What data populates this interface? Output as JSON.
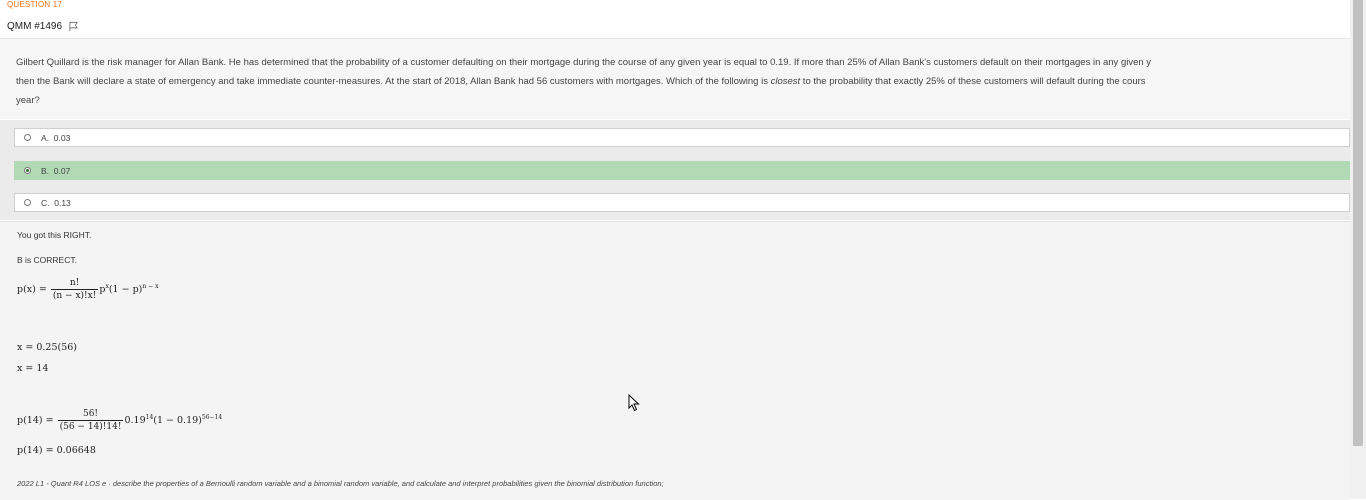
{
  "header": {
    "section_label": "QUESTION 17",
    "question_id": "QMM #1496"
  },
  "question": {
    "line1": "Gilbert Quillard is the risk manager for Allan Bank.  He has determined that the probability of a customer defaulting on their mortgage during the course of any given year is equal to 0.19.  If more than 25% of Allan Bank's customers default on their mortgages in any given y",
    "line2_pre": "then the Bank will declare a state of emergency and take immediate counter-measures.  At the start of 2018, Allan Bank had 56 customers with mortgages.  Which of the following is ",
    "line2_em": "closest",
    "line2_post": " to the probability that exactly 25% of these customers will default during the cours",
    "line3": "year?"
  },
  "options": [
    {
      "letter": "A.",
      "value": "0.03",
      "selected": false
    },
    {
      "letter": "B.",
      "value": "0.07",
      "selected": true
    },
    {
      "letter": "C.",
      "value": "0.13",
      "selected": false
    }
  ],
  "explanation": {
    "result": "You got this RIGHT.",
    "correct": "B is CORRECT.",
    "formula_lhs": "p(x) =",
    "formula_num": "n!",
    "formula_den": "(n − x)!x!",
    "x_line1": "x = 0.25(56)",
    "x_line2": "x = 14",
    "calc_lhs": "p(14) =",
    "calc_num": "56!",
    "calc_den": "(56 − 14)!14!",
    "calc_rhs_a": "0.19",
    "calc_rhs_b": "14",
    "calc_rhs_c": "(1 − 0.19)",
    "calc_rhs_d": "56−14",
    "answer_line": "p(14) = 0.06648",
    "los": "2022 L1 - Quant R4 LOS e · describe the properties of a Bernoulli random variable and a binomial random variable, and calculate and interpret probabilities given the binomial distribution function;"
  },
  "colors": {
    "accent": "#e8731a",
    "correct_bg": "#b1d9b4"
  }
}
